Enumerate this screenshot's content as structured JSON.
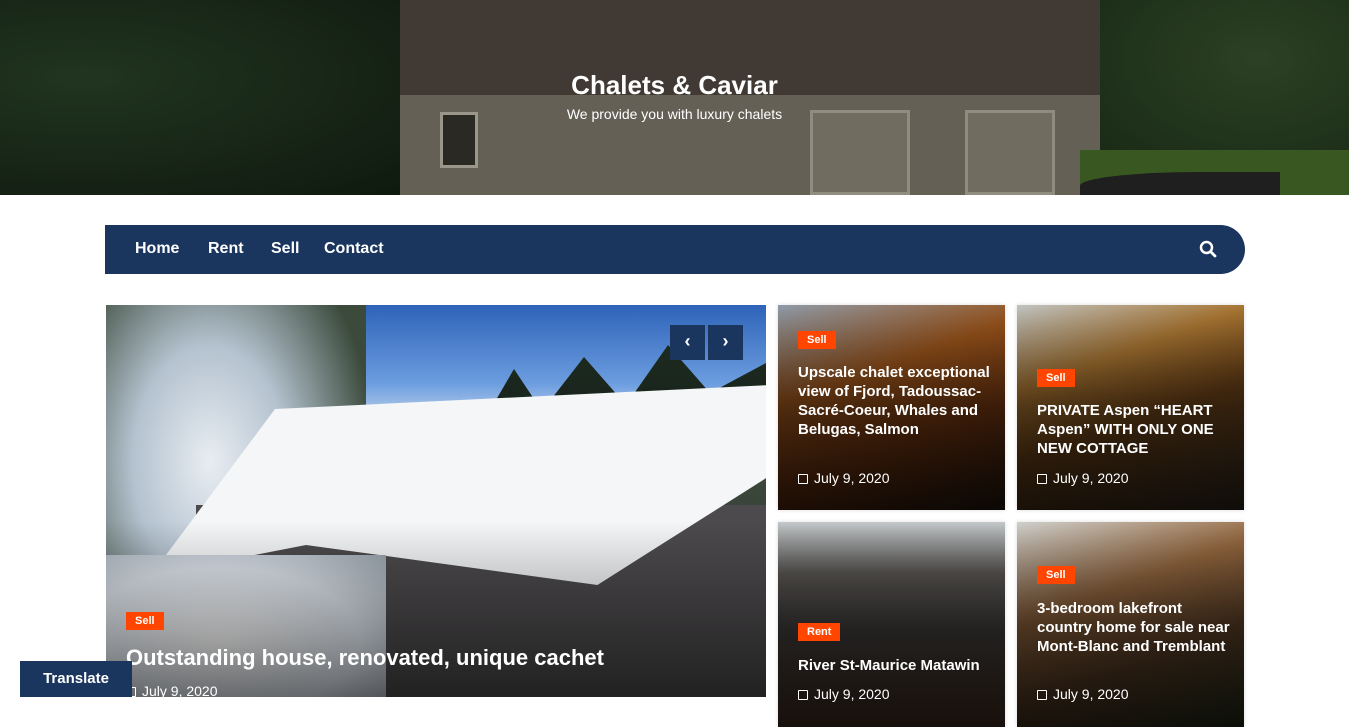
{
  "header": {
    "title": "Chalets & Caviar",
    "tagline": "We provide you with luxury chalets"
  },
  "nav": {
    "items": [
      "Home",
      "Rent",
      "Sell",
      "Contact"
    ],
    "search_icon": "search-icon"
  },
  "featured": {
    "badge": "Sell",
    "title": "Outstanding house, renovated, unique cachet",
    "date": "July 9, 2020",
    "prev_icon": "chevron-left-icon",
    "next_icon": "chevron-right-icon"
  },
  "cards": [
    {
      "badge": "Sell",
      "title": "Upscale chalet exceptional view of Fjord, Tadoussac-Sacré-Coeur, Whales and Belugas, Salmon",
      "date": "July 9, 2020"
    },
    {
      "badge": "Sell",
      "title": "PRIVATE Aspen “HEART Aspen” WITH ONLY ONE NEW COTTAGE",
      "date": "July 9, 2020"
    },
    {
      "badge": "Rent",
      "title": "River St-Maurice Matawin",
      "date": "July 9, 2020"
    },
    {
      "badge": "Sell",
      "title": "3-bedroom lakefront country home for sale near Mont-Blanc and Tremblant",
      "date": "July 9, 2020"
    }
  ],
  "translate": "Translate",
  "colors": {
    "nav": "#1a355e",
    "badge": "#ff4500"
  }
}
